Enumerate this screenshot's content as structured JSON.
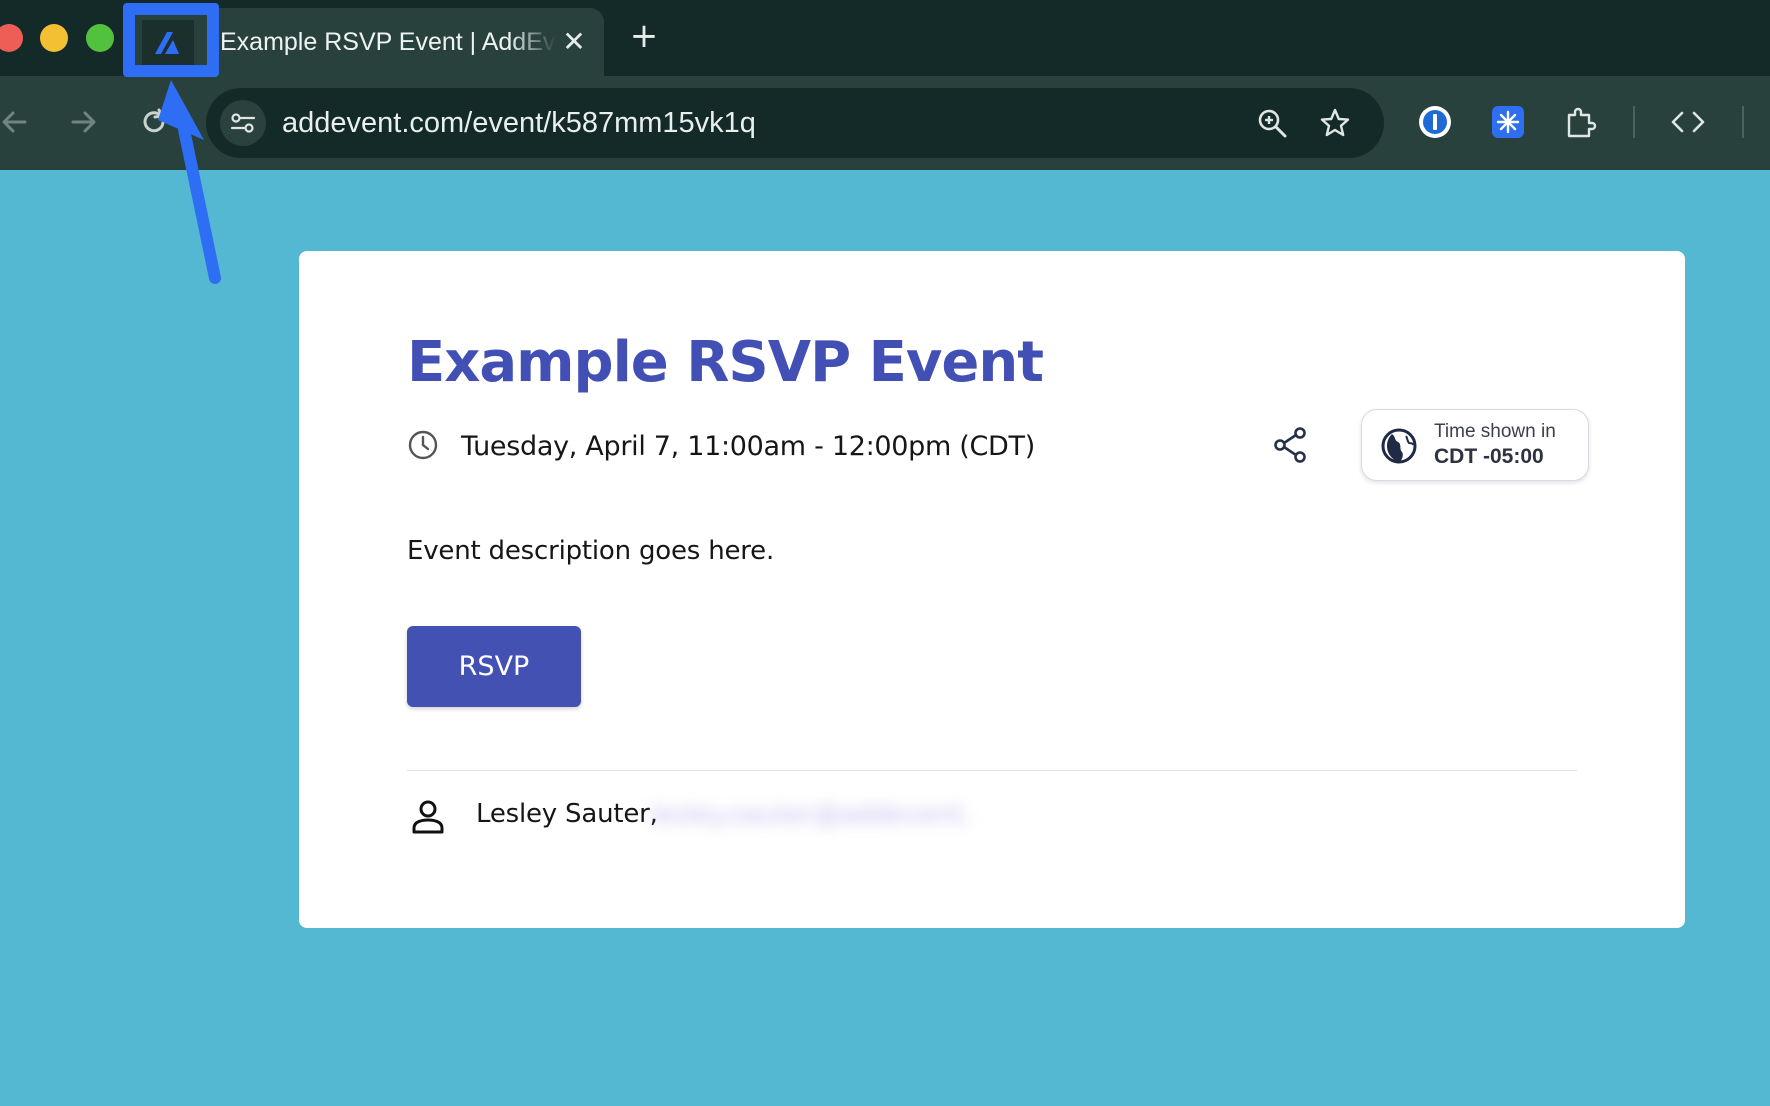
{
  "browser": {
    "tab": {
      "title": "Example RSVP Event | AddEvent",
      "close_glyph": "✕",
      "favicon": "addevent-logo-icon"
    },
    "new_tab_glyph": "+",
    "address_bar": {
      "url": "addevent.com/event/k587mm15vk1q"
    },
    "icons": [
      "back-arrow-icon",
      "forward-arrow-icon",
      "reload-icon",
      "site-settings-icon",
      "zoom-icon",
      "bookmark-star-icon",
      "password-manager-extension-icon",
      "snowflake-extension-icon",
      "extensions-puzzle-icon",
      "code-icon"
    ]
  },
  "annotation": {
    "color": "#2e6ef5"
  },
  "event": {
    "title": "Example RSVP Event",
    "datetime": "Tuesday, April 7, 11:00am - 12:00pm (CDT)",
    "timezone": {
      "label": "Time shown in",
      "value": "CDT -05:00"
    },
    "description": "Event description goes here.",
    "rsvp_label": "RSVP",
    "organizer": {
      "name": "Lesley Sauter,",
      "email": "lesley.sauter@addevent.com"
    }
  },
  "colors": {
    "page_background": "#55b8d2",
    "accent": "#4351b3",
    "title": "#4250b5"
  }
}
